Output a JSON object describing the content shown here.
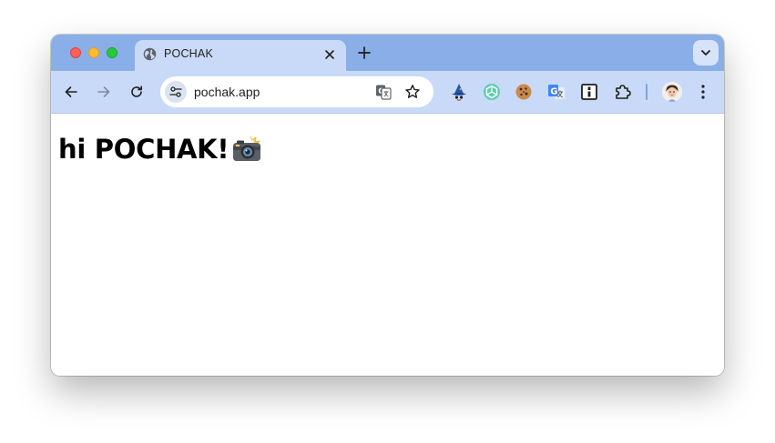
{
  "window": {
    "traffic_lights": [
      "close",
      "minimize",
      "zoom"
    ]
  },
  "tab": {
    "title": "POCHAK",
    "favicon": "globe-icon",
    "close_icon": "close-icon"
  },
  "tabstrip": {
    "new_tab_label": "+",
    "tab_search_icon": "chevron-down-icon"
  },
  "toolbar": {
    "back_icon": "arrow-left-icon",
    "forward_icon": "arrow-right-icon",
    "reload_icon": "reload-icon",
    "omnibox": {
      "url": "pochak.app",
      "site_info_icon": "tune-icon",
      "translate_icon": "translate-icon",
      "bookmark_icon": "star-icon"
    },
    "extensions": [
      "wizard-hat-icon",
      "openai-knot-icon",
      "cookie-icon",
      "google-translate-icon",
      "info-box-icon",
      "puzzle-piece-icon"
    ],
    "profile_icon": "avatar",
    "menu_icon": "kebab-menu-icon"
  },
  "page": {
    "heading": "hi POCHAK!",
    "heading_emoji": "camera-with-flash-icon"
  },
  "colors": {
    "tabstrip_bg": "#8aaee8",
    "toolbar_bg": "#c9daf8",
    "omnibox_bg": "#ffffff",
    "page_bg": "#ffffff"
  }
}
